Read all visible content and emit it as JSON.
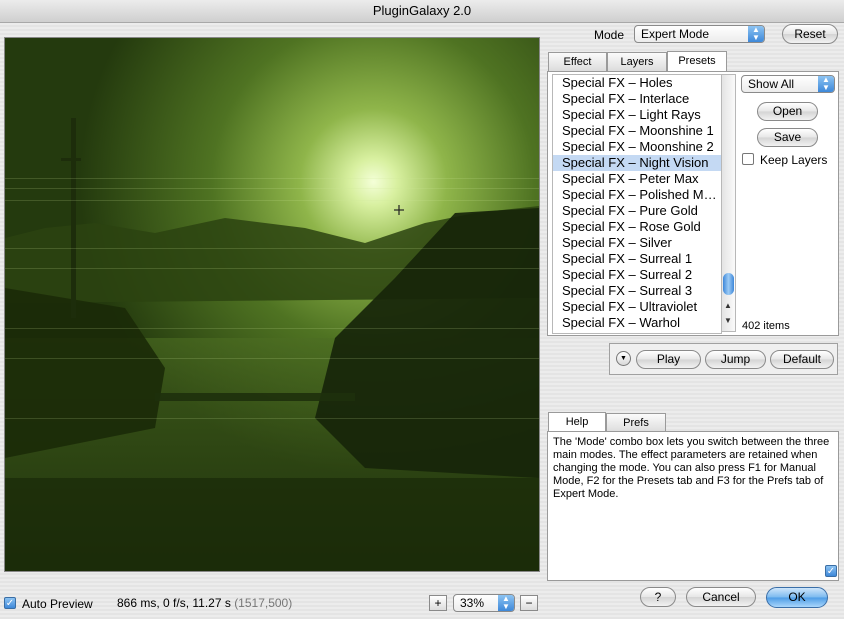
{
  "window": {
    "title": "PluginGalaxy 2.0"
  },
  "mode": {
    "label": "Mode",
    "value": "Expert Mode",
    "reset_label": "Reset"
  },
  "tabs": [
    "Effect",
    "Layers",
    "Presets"
  ],
  "presets": {
    "filter_value": "Show All",
    "items": [
      "Special FX – Holes",
      "Special FX – Interlace",
      "Special FX – Light Rays",
      "Special FX – Moonshine 1",
      "Special FX – Moonshine 2",
      "Special FX – Night Vision",
      "Special FX – Peter Max",
      "Special FX – Polished M…",
      "Special FX – Pure Gold",
      "Special FX – Rose Gold",
      "Special FX – Silver",
      "Special FX – Surreal 1",
      "Special FX – Surreal 2",
      "Special FX – Surreal 3",
      "Special FX – Ultraviolet",
      "Special FX – Warhol"
    ],
    "selected_index": 5,
    "open_label": "Open",
    "save_label": "Save",
    "keep_layers_label": "Keep Layers",
    "count_text": "402 items"
  },
  "playback": {
    "play_label": "Play",
    "jump_label": "Jump",
    "default_label": "Default"
  },
  "help_tabs": [
    "Help",
    "Prefs"
  ],
  "help": {
    "text": "The 'Mode' combo box lets you switch between the three main modes. The effect parameters are retained when changing the mode. You can also press F1 for Manual Mode, F2 for the Presets tab and F3 for the Prefs tab of Expert Mode."
  },
  "footer": {
    "auto_preview_label": "Auto Preview",
    "stats": "866 ms, 0 f/s, 11.27 s",
    "coords": "(1517,500)",
    "zoom_plus": "+",
    "zoom_value": "33%",
    "zoom_minus": "−",
    "help_label": "?",
    "cancel_label": "Cancel",
    "ok_label": "OK"
  },
  "colors": {
    "accent": "#4d9ce6",
    "selection": "#c4d9f3",
    "preview_tint": "#4a6b1c"
  }
}
